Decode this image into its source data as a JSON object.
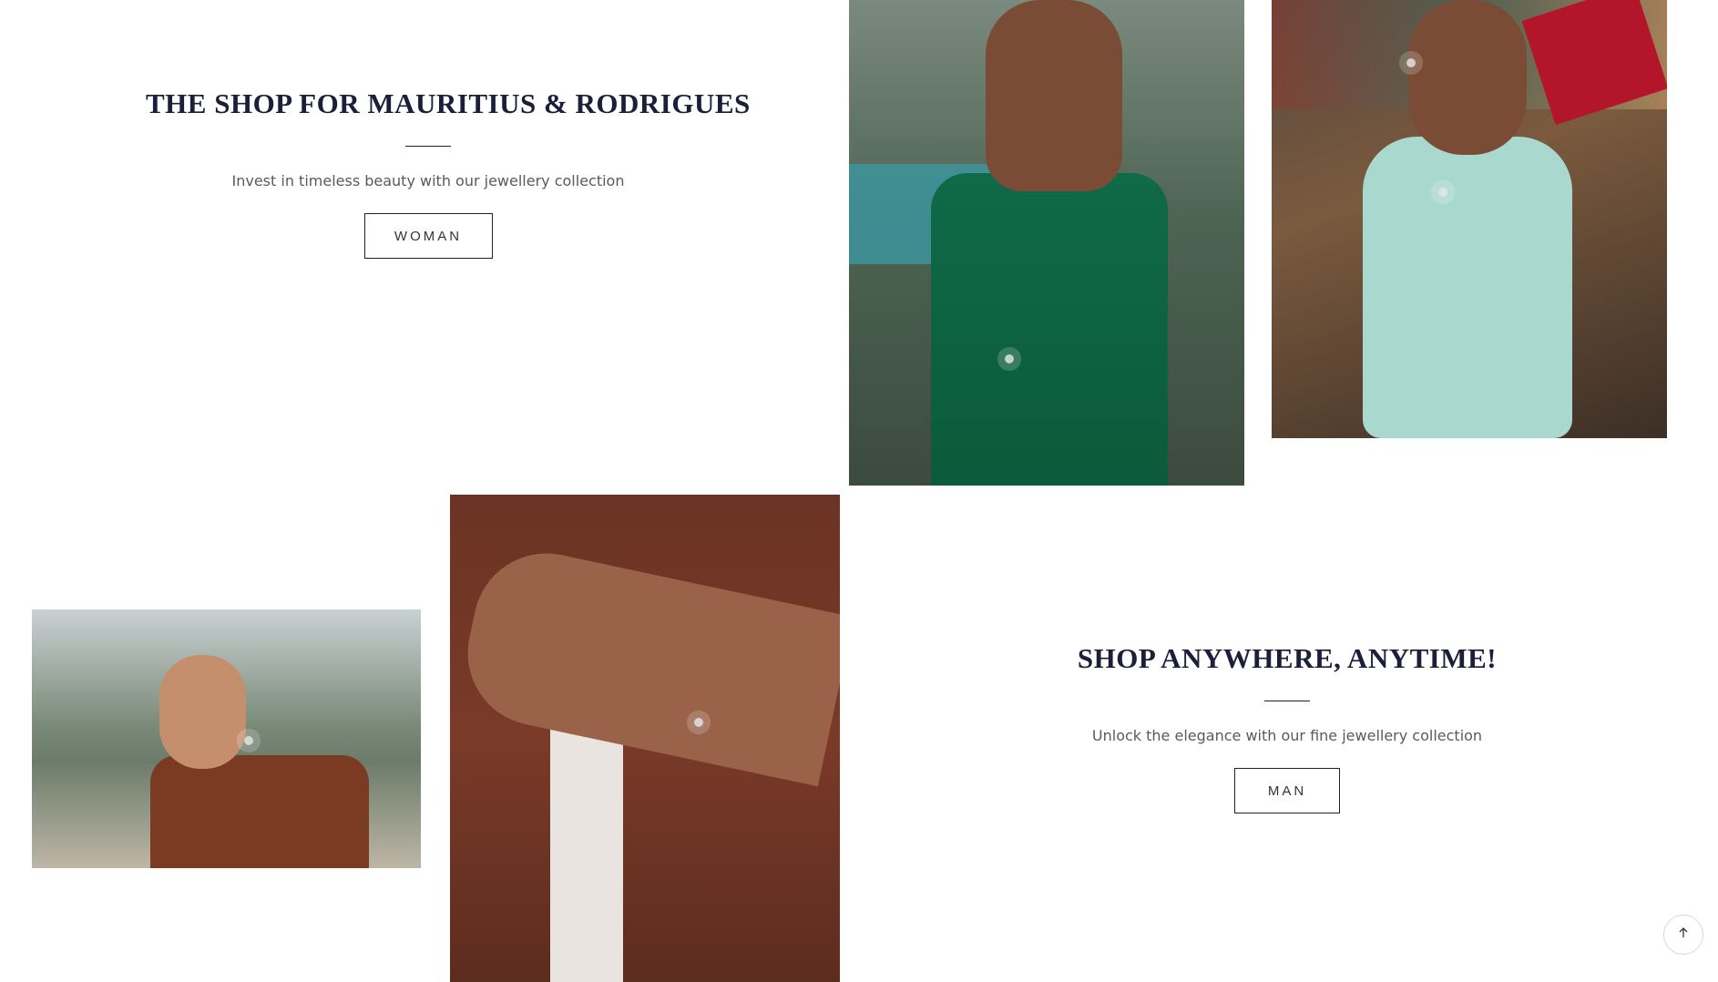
{
  "top_block": {
    "title": "THE SHOP FOR MAURITIUS & RODRIGUES",
    "subtitle": "Invest in timeless beauty with our jewellery collection",
    "button_label": "WOMAN"
  },
  "bottom_block": {
    "title": "SHOP ANYWHERE, ANYTIME!",
    "subtitle": "Unlock the elegance with our fine jewellery collection",
    "button_label": "MAN"
  },
  "images": {
    "green_dress": "woman-green-dress-photo",
    "teal_dress": "woman-reading-book-photo",
    "man_portrait": "man-portrait-photo",
    "shirt_bracelet": "bracelet-closeup-photo"
  },
  "icons": {
    "scroll_top": "arrow-up-icon"
  },
  "colors": {
    "title": "#1b1f3a",
    "subtitle": "#5a5a5a",
    "button_border": "#222222",
    "background": "#ffffff"
  }
}
